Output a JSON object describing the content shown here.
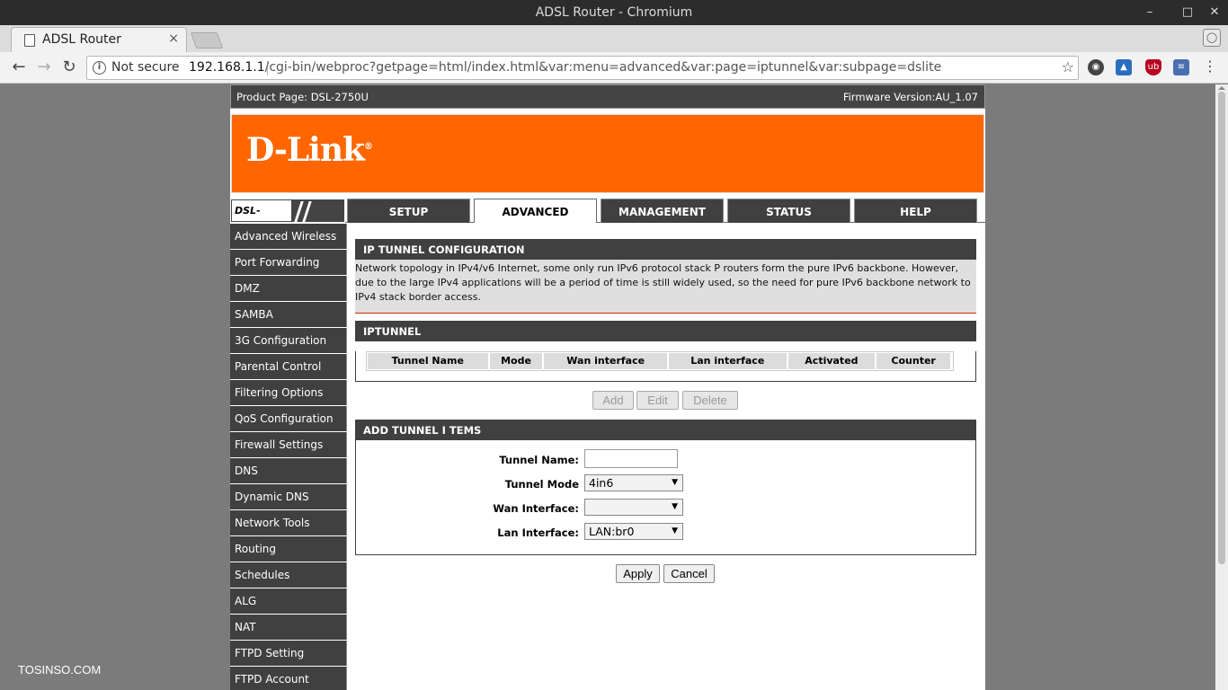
{
  "window": {
    "title": "ADSL Router - Chromium",
    "controls": [
      "✕"
    ]
  },
  "tab": {
    "title": "ADSL Router",
    "close": "×",
    "profile_icon": "person-icon"
  },
  "toolbar": {
    "back": "←",
    "forward": "→",
    "reload": "↻",
    "security": "Not secure",
    "url_host": "192.168.1.1",
    "url_path": "/cgi-bin/webproc?getpage=html/index.html&var:menu=advanced&var:page=iptunnel&var:subpage=dslite",
    "star": "☆",
    "menu": "⋮",
    "extensions": [
      {
        "name": "chromecast-icon",
        "color": "#444444"
      },
      {
        "name": "extension-icon",
        "color": "#2a6ebd"
      },
      {
        "name": "ublock-icon",
        "color": "#b8001f"
      },
      {
        "name": "translate-icon",
        "color": "#4a6fb0"
      }
    ]
  },
  "router": {
    "product_page": "Product Page: DSL-2750U",
    "firmware": "Firmware Version:AU_1.07",
    "logo": "D-Link",
    "logo_mark": "®",
    "model": "DSL-2750U",
    "nav_tabs": [
      "SETUP",
      "ADVANCED",
      "MANAGEMENT",
      "STATUS",
      "HELP"
    ],
    "active_tab": "ADVANCED",
    "sidebar": [
      "Advanced Wireless",
      "Port Forwarding",
      "DMZ",
      "SAMBA",
      "3G Configuration",
      "Parental Control",
      "Filtering Options",
      "QoS Configuration",
      "Firewall Settings",
      "DNS",
      "Dynamic DNS",
      "Network Tools",
      "Routing",
      "Schedules",
      "ALG",
      "NAT",
      "FTPD Setting",
      "FTPD Account"
    ],
    "config_title": "IP TUNNEL CONFIGURATION",
    "config_desc": "Network topology in IPv4/v6 Internet, some only run IPv6 protocol stack P routers form the pure IPv6 backbone. However, due to the large IPv4 applications will be a period of time is still widely used, so the need for pure IPv6 backbone network to IPv4 stack border access.",
    "iptunnel_title": "IPTUNNEL",
    "columns": [
      "Tunnel Name",
      "Mode",
      "Wan interface",
      "Lan interface",
      "Activated",
      "Counter"
    ],
    "buttons": {
      "add": "Add",
      "edit": "Edit",
      "delete": "Delete"
    },
    "add_title": "ADD TUNNEL I TEMS",
    "form": {
      "tunnel_name_label": "Tunnel Name:",
      "tunnel_name_value": "",
      "tunnel_mode_label": "Tunnel Mode",
      "tunnel_mode_value": "4in6",
      "wan_label": "Wan Interface:",
      "wan_value": "",
      "lan_label": "Lan Interface:",
      "lan_value": "LAN:br0"
    },
    "apply": "Apply",
    "cancel": "Cancel"
  },
  "watermark": "TOSINSO.COM"
}
